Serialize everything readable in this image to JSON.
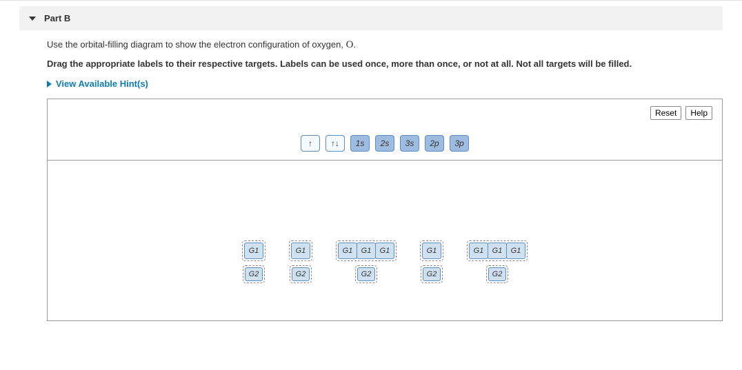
{
  "part": {
    "title": "Part B"
  },
  "prompt": {
    "text_before_symbol": "Use the orbital-filling diagram to show the electron configuration of oxygen, ",
    "symbol": "O",
    "text_after_symbol": "."
  },
  "instruction": "Drag the appropriate labels to their respective targets. Labels can be used once, more than once, or not at all. Not all targets will be filled.",
  "hints_toggle": "View Available Hint(s)",
  "buttons": {
    "reset": "Reset",
    "help": "Help"
  },
  "labels": {
    "arrow_up": "↑",
    "arrow_pair": "↑↓",
    "orb_1s": "1s",
    "orb_2s": "2s",
    "orb_3s": "3s",
    "orb_2p": "2p",
    "orb_3p": "3p"
  },
  "targets": {
    "g1": "G1",
    "g2": "G2"
  },
  "groups": [
    {
      "boxes": 1
    },
    {
      "boxes": 1
    },
    {
      "boxes": 3
    },
    {
      "boxes": 1
    },
    {
      "boxes": 3
    }
  ]
}
